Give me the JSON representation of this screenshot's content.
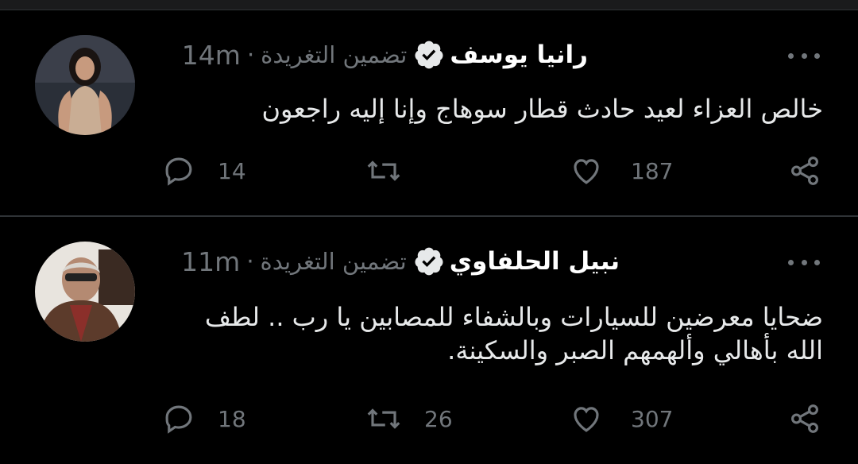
{
  "tweets": [
    {
      "name": "رانيا يوسف",
      "embed_label": "تضمين التغريدة",
      "time": "14m",
      "text": "خالص العزاء لعيد حادث قطار سوهاج وإنا إليه راجعون",
      "replies": "14",
      "retweets": "",
      "likes": "187"
    },
    {
      "name": "نبيل الحلفاوي",
      "embed_label": "تضمين التغريدة",
      "time": "11m",
      "text_line1": "ضحايا معرضين للسيارات وبالشفاء للمصابين يا رب .. لطف",
      "text_line2": "الله بأهالي وألهمهم الصبر والسكينة.",
      "replies": "18",
      "retweets": "26",
      "likes": "307"
    }
  ],
  "colors": {
    "background": "#000000",
    "muted": "#71767b",
    "divider": "#2f3336",
    "verified_badge": "#e7e9ea"
  }
}
